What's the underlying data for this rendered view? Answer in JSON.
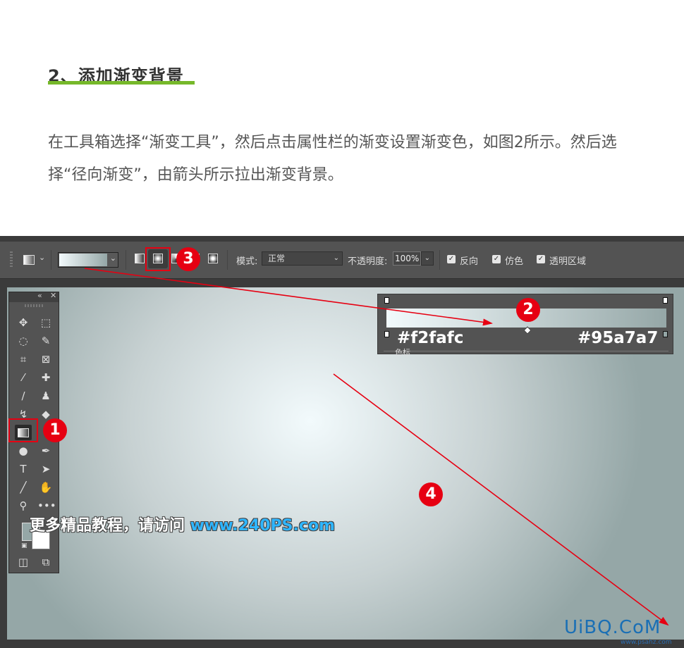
{
  "article": {
    "title": "2、添加渐变背景",
    "body": "在工具箱选择“渐变工具”，然后点击属性栏的渐变设置渐变色，如图2所示。然后选择“径向渐变”，由箭头所示拉出渐变背景。"
  },
  "colors": {
    "accent_underline": "#76b82a",
    "annotation_red": "#e60012",
    "gradient_start": "#f2fafc",
    "gradient_end": "#95a7a7"
  },
  "options_bar": {
    "mode_label": "模式:",
    "mode_value": "正常",
    "opacity_label": "不透明度:",
    "opacity_value": "100%",
    "checkboxes": [
      {
        "label": "反向",
        "checked": true
      },
      {
        "label": "仿色",
        "checked": true
      },
      {
        "label": "透明区域",
        "checked": true
      }
    ],
    "gradient_types": [
      "linear",
      "radial",
      "angle",
      "reflected",
      "diamond"
    ],
    "selected_gradient_type": "radial"
  },
  "gradient_editor": {
    "start_color_label": "#f2fafc",
    "end_color_label": "#95a7a7",
    "section_label": "色标"
  },
  "badges": [
    "1",
    "2",
    "3",
    "4"
  ],
  "tools_icons": [
    "move-icon",
    "marquee-icon",
    "lasso-icon",
    "quick-select-icon",
    "crop-icon",
    "frame-icon",
    "eyedropper-icon",
    "healing-icon",
    "brush-icon",
    "stamp-icon",
    "history-brush-icon",
    "eraser-icon",
    "gradient-icon",
    "blur-icon",
    "dodge-icon",
    "pen-icon",
    "type-icon",
    "path-select-icon",
    "line-icon",
    "hand-icon",
    "zoom-icon",
    "more-icon"
  ],
  "promo": {
    "text": "更多精品教程，请访问 ",
    "url": "www.240PS.com"
  },
  "watermark": {
    "logo": "UiBQ.CoM",
    "url": "www.psahz.com"
  }
}
